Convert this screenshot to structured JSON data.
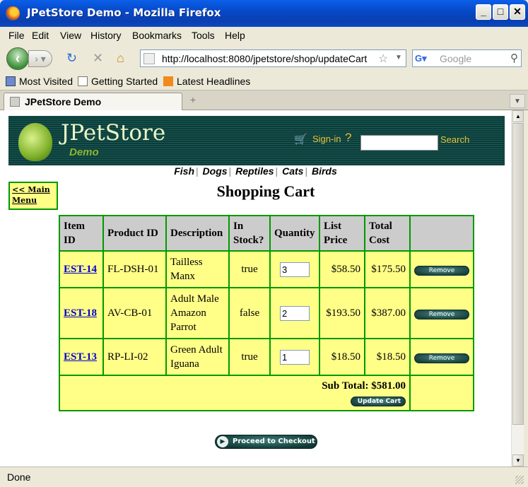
{
  "window": {
    "title": "JPetStore Demo - Mozilla Firefox"
  },
  "menu": [
    "File",
    "Edit",
    "View",
    "History",
    "Bookmarks",
    "Tools",
    "Help"
  ],
  "nav": {
    "url": "http://localhost:8080/jpetstore/shop/updateCart",
    "search_placeholder": "Google"
  },
  "bookmarks": [
    "Most Visited",
    "Getting Started",
    "Latest Headlines"
  ],
  "tab": {
    "title": "JPetStore Demo"
  },
  "store": {
    "logo": "JPetStore",
    "logo_sub": "Demo",
    "signin": "Sign-in",
    "search_button": "Search",
    "categories": [
      "Fish",
      "Dogs",
      "Reptiles",
      "Cats",
      "Birds"
    ],
    "main_menu": "<< Main Menu",
    "page_title": "Shopping Cart"
  },
  "cart": {
    "headers": [
      "Item ID",
      "Product ID",
      "Description",
      "In Stock?",
      "Quantity",
      "List Price",
      "Total Cost",
      ""
    ],
    "rows": [
      {
        "item_id": "EST-14",
        "product_id": "FL-DSH-01",
        "description": "Tailless Manx",
        "in_stock": "true",
        "quantity": "3",
        "list_price": "$58.50",
        "total_cost": "$175.50",
        "action": "Remove"
      },
      {
        "item_id": "EST-18",
        "product_id": "AV-CB-01",
        "description": "Adult Male Amazon Parrot",
        "in_stock": "false",
        "quantity": "2",
        "list_price": "$193.50",
        "total_cost": "$387.00",
        "action": "Remove"
      },
      {
        "item_id": "EST-13",
        "product_id": "RP-LI-02",
        "description": "Green Adult Iguana",
        "in_stock": "true",
        "quantity": "1",
        "list_price": "$18.50",
        "total_cost": "$18.50",
        "action": "Remove"
      }
    ],
    "subtotal": "Sub Total: $581.00",
    "update_button": "Update Cart",
    "checkout_button": "Proceed to Checkout"
  },
  "status": {
    "text": "Done"
  }
}
